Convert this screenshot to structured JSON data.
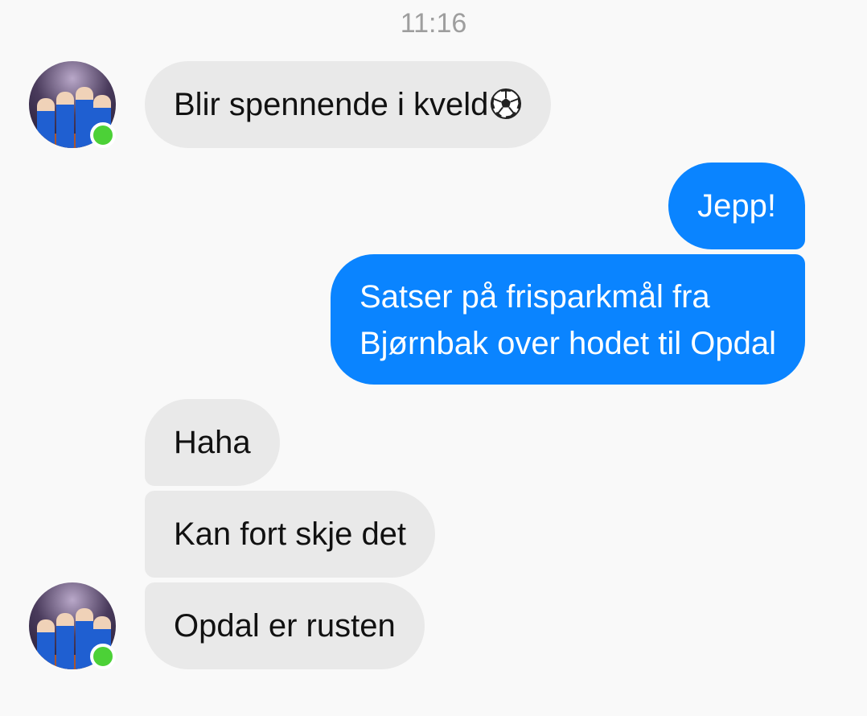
{
  "chat": {
    "timestamp": "11:16",
    "messages": [
      {
        "sender": "other",
        "text": "Blir spennende i kveld",
        "icon": "soccer-ball-icon"
      },
      {
        "sender": "me",
        "text": "Jepp!"
      },
      {
        "sender": "me",
        "lines": [
          "Satser på frisparkmål fra",
          "Bjørnbak over hodet til Opdal"
        ]
      },
      {
        "sender": "other",
        "text": "Haha"
      },
      {
        "sender": "other",
        "text": "Kan fort skje det"
      },
      {
        "sender": "other",
        "text": "Opdal er rusten"
      }
    ]
  },
  "colors": {
    "outgoing_bubble": "#0a84ff",
    "incoming_bubble": "#e9e9e9",
    "online_dot": "#4cd137",
    "background": "#f9f9f9"
  }
}
